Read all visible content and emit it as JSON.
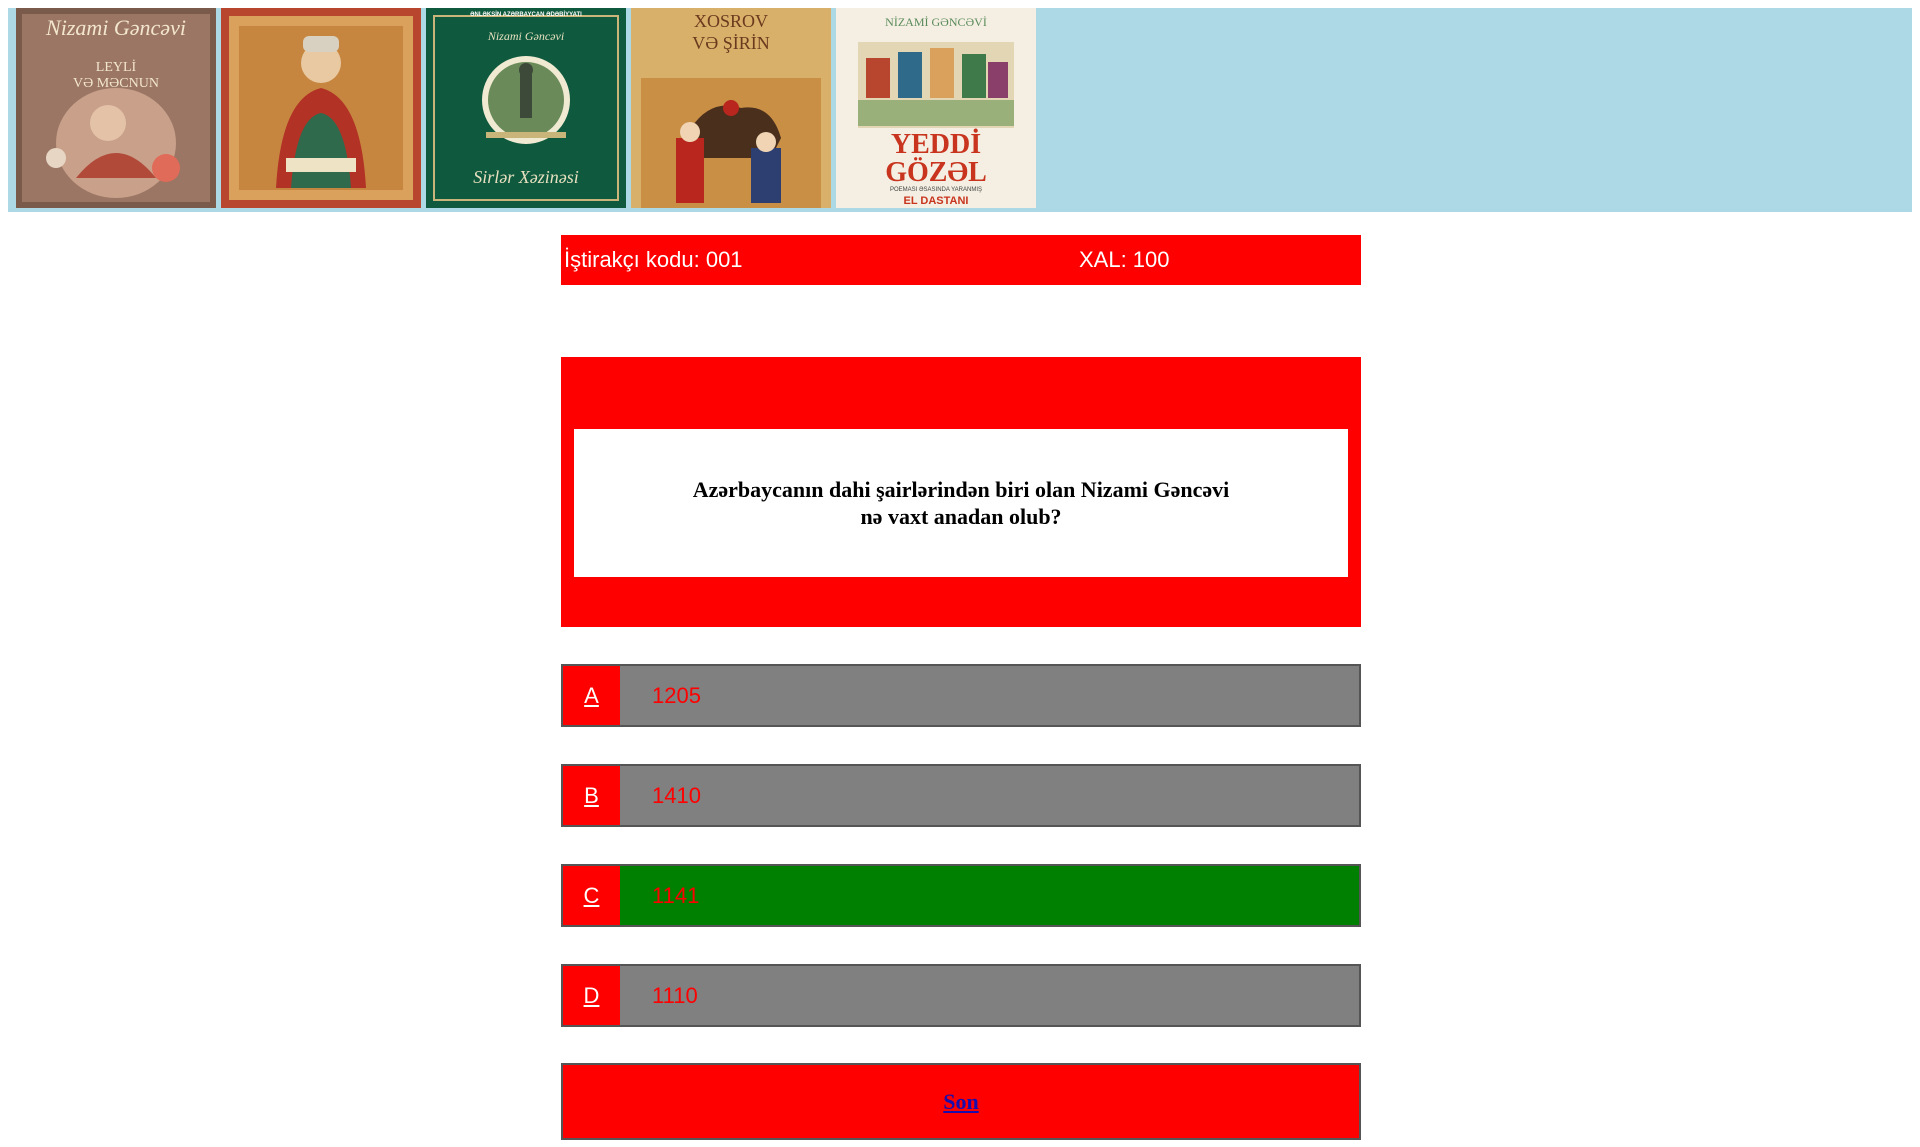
{
  "banner": {
    "background": "#add8e6",
    "covers": [
      {
        "name": "leyli-ve-mecnun-cover",
        "line1": "Nizami Gəncəvi",
        "line2": "LEYLİ",
        "line3": "VƏ MƏCNUN"
      },
      {
        "name": "nizami-portrait-cover"
      },
      {
        "name": "sirler-xezinesi-cover",
        "top": "ƏNLƏKSİN AZƏRBAYCAN ƏDƏBİYYATI",
        "author": "Nizami Gəncəvi",
        "bottom": "Sirlər Xəzinəsi"
      },
      {
        "name": "xosrov-ve-sirin-cover",
        "line1": "XOSROV",
        "line2": "VƏ ŞİRİN"
      },
      {
        "name": "yeddi-gozel-cover",
        "author": "NİZAMİ GƏNCƏVİ",
        "title1": "YEDDİ",
        "title2": "GÖZƏL",
        "sub": "POEMASI ƏSASINDA YARANMIŞ",
        "sub2": "EL DASTANI"
      }
    ]
  },
  "info": {
    "participant_code": "İştirakçı kodu: 001",
    "score": "XAL: 100"
  },
  "question": {
    "line1": "Azərbaycanın dahi şairlərindən biri olan Nizami Gəncəvi",
    "line2": "nə vaxt anadan olub?"
  },
  "answers": [
    {
      "letter": "A",
      "value": "1205",
      "state": "default"
    },
    {
      "letter": "B",
      "value": "1410",
      "state": "default"
    },
    {
      "letter": "C",
      "value": "1141",
      "state": "correct"
    },
    {
      "letter": "D",
      "value": "1110",
      "state": "default"
    }
  ],
  "end_button": {
    "label": "Son"
  },
  "colors": {
    "accent": "#ff0000",
    "answer_default": "#808080",
    "answer_correct": "#008000",
    "link": "#1a0dab"
  }
}
